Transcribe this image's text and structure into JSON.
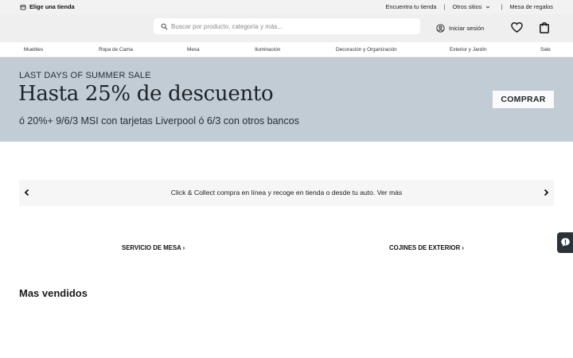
{
  "utility_bar": {
    "store_picker": "Elige una tienda",
    "links": {
      "find_store": "Encuentra tu tienda",
      "other_sites": "Otros sitios",
      "registry": "Mesa de regalos"
    }
  },
  "header": {
    "search_placeholder": "Buscar por producto, categoría y más...",
    "login_label": "Iniciar sesión"
  },
  "nav": {
    "items": [
      "Muebles",
      "Ropa de Cama",
      "Mesa",
      "Iluminación",
      "Decoración y Organización",
      "Exterior y Jardín",
      "Sale"
    ]
  },
  "hero": {
    "kicker": "LAST DAYS OF SUMMER SALE",
    "title": "Hasta 25% de descuento",
    "subtitle": "ó 20%+ 9/6/3 MSI con tarjetas Liverpool ó 6/3 con otros bancos",
    "cta": "COMPRAR"
  },
  "promo": {
    "text": "Click & Collect compra en línea y recoge en tienda o desde tu auto. Ver más"
  },
  "features": {
    "left": "SERVICIO DE MESA ›",
    "right": "COJINES DE EXTERIOR ›"
  },
  "sections": {
    "best_sellers": "Mas vendidos"
  },
  "icons": {
    "store": "store-icon",
    "chevron": "chevron-down-icon",
    "search": "search-icon",
    "user": "user-circle-icon",
    "wishlist": "heart-icon",
    "cart": "shopping-bag-icon",
    "prev": "chevron-left-icon",
    "next": "chevron-right-icon",
    "chat": "chat-icon"
  },
  "colors": {
    "hero_bg": "#c1ccd4",
    "header_bg": "#efefef",
    "utility_bg": "#f2f2f2",
    "chat_tab": "#2b3238"
  }
}
